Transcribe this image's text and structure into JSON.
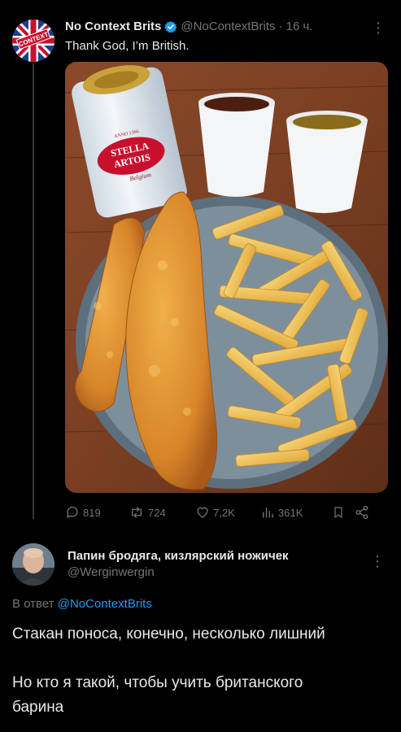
{
  "tweet": {
    "author_name": "No Context Brits",
    "author_handle": "@NoContextBrits",
    "time": "· 16 ч.",
    "text": "Thank God, I’m British.",
    "avatar_text": "CONTEXT",
    "media": {
      "can_brand_1": "STELLA",
      "can_brand_2": "ARTOIS",
      "can_sub": "Belgium",
      "can_est": "ANNO 1366"
    },
    "stats": {
      "replies": "819",
      "reposts": "724",
      "likes": "7,2K",
      "views": "361K"
    }
  },
  "reply": {
    "author_name": "Папин бродяга, кизлярский ножичек",
    "author_handle": "@Werginwergin",
    "reply_prefix": "В ответ",
    "reply_mention": "@NoContextBrits",
    "line1": "Стакан поноса, конечно, несколько лишний",
    "line2": "Но кто я такой, чтобы учить британского",
    "line3": "барина"
  },
  "colors": {
    "background": "#000000",
    "text_primary": "#e7e9ea",
    "text_secondary": "#71767b",
    "accent": "#1d9bf0"
  }
}
